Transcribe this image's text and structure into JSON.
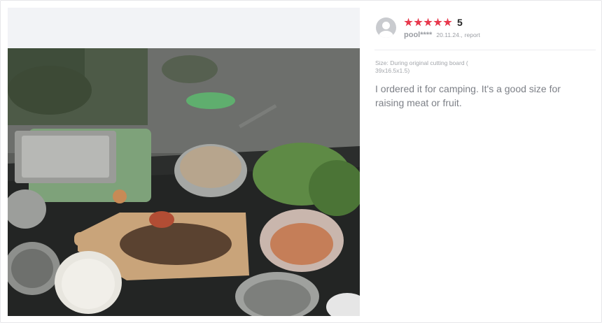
{
  "review": {
    "rating": "5",
    "stars_filled": 5,
    "stars_total": 5,
    "user": "pool****",
    "date": "20.11.24.",
    "separator": ",",
    "report_label": "report",
    "size": "Size: During original cutting board ( 39x16.5x1.5)",
    "text": "I ordered it for camping. It's a good size for raising meat or fruit.",
    "star_color": "#e8394d"
  },
  "photo": {
    "subject": "camping-table-food-photo"
  }
}
